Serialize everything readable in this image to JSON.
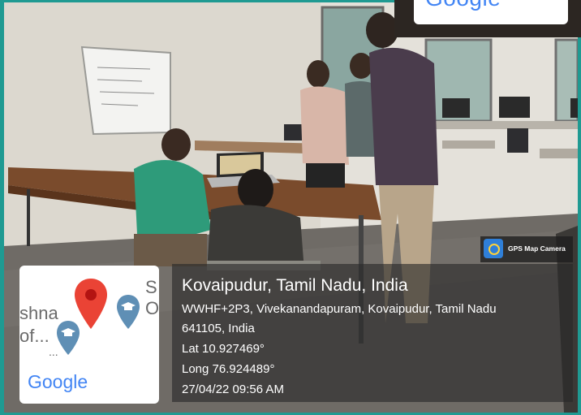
{
  "thumb_brand": "Google",
  "gps_badge": {
    "label": "GPS Map Camera",
    "icon": "camera-pin-icon"
  },
  "map": {
    "labels": [
      "shna",
      "of...",
      "S",
      "O",
      "..."
    ],
    "brand": "Google",
    "icons": [
      "red-location-pin-icon",
      "school-pin-icon"
    ]
  },
  "location": {
    "title": "Kovaipudur, Tamil Nadu, India",
    "address_line1": "WWHF+2P3, Vivekanandapuram, Kovaipudur, Tamil Nadu",
    "address_line2": "641105, India",
    "lat": "Lat 10.927469°",
    "long": "Long 76.924489°",
    "datetime": "27/04/22 09:56 AM"
  },
  "colors": {
    "frame": "#1f9a92",
    "pin": "#ea4335",
    "school_pin": "#5f8fb5"
  }
}
